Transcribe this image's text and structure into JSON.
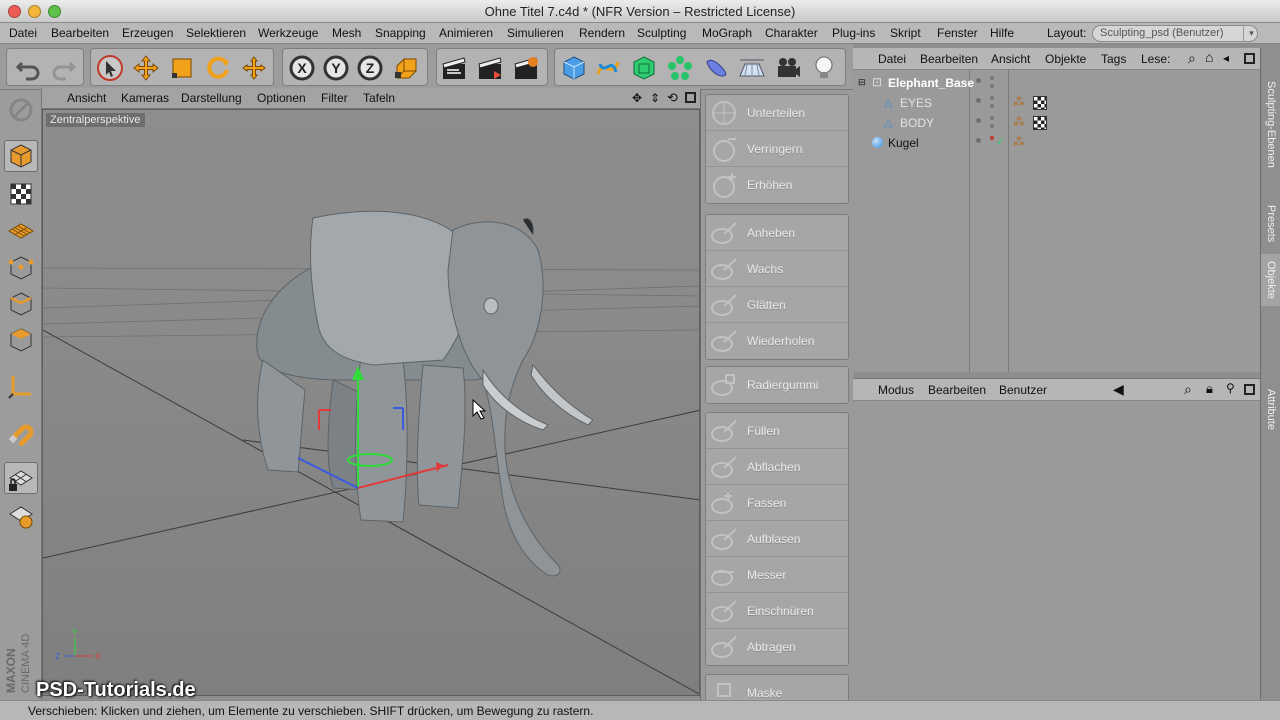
{
  "window": {
    "title": "Ohne Titel 7.c4d * (NFR Version – Restricted License)"
  },
  "menubar": {
    "items": [
      "Datei",
      "Bearbeiten",
      "Erzeugen",
      "Selektieren",
      "Werkzeuge",
      "Mesh",
      "Snapping",
      "Animieren",
      "Simulieren",
      "Rendern",
      "Sculpting",
      "MoGraph",
      "Charakter",
      "Plug-ins",
      "Skript",
      "Fenster",
      "Hilfe"
    ],
    "layout_label": "Layout:",
    "layout_value": "Sculpting_psd (Benutzer)"
  },
  "viewport": {
    "menu": [
      "Ansicht",
      "Kameras",
      "Darstellung",
      "Optionen",
      "Filter",
      "Tafeln"
    ],
    "label": "Zentralperspektive"
  },
  "sculpt_tools": {
    "group1": [
      "Unterteilen",
      "Verringern",
      "Erhöhen"
    ],
    "group2": [
      "Anheben",
      "Wachs",
      "Glätten",
      "Wiederholen"
    ],
    "group3": [
      "Radiergummi"
    ],
    "group4": [
      "Füllen",
      "Abflachen",
      "Fassen",
      "Aufblasen",
      "Messer",
      "Einschnüren",
      "Abtragen"
    ],
    "group5": [
      "Maske"
    ]
  },
  "objects": {
    "menu": [
      "Datei",
      "Bearbeiten",
      "Ansicht",
      "Objekte",
      "Tags",
      "Lese:"
    ],
    "items": [
      {
        "name": "Elephant_Base",
        "level": 0
      },
      {
        "name": "EYES",
        "level": 1
      },
      {
        "name": "BODY",
        "level": 1
      },
      {
        "name": "Kugel",
        "level": 0
      }
    ]
  },
  "attributes": {
    "menu": [
      "Modus",
      "Bearbeiten",
      "Benutzer"
    ]
  },
  "right_tabs": [
    "Sculpting-Ebenen",
    "Presets",
    "Objekte",
    "Attribute"
  ],
  "status": "Verschieben: Klicken und ziehen, um Elemente zu verschieben. SHIFT drücken, um Bewegung zu rastern.",
  "watermark": "PSD-Tutorials.de",
  "vertical_logo": "MAXON CINEMA 4D",
  "colors": {
    "accent_orange": "#f2a11a",
    "panel_gray": "#9a9a9a",
    "selection_blue": "#3f8fd9"
  }
}
